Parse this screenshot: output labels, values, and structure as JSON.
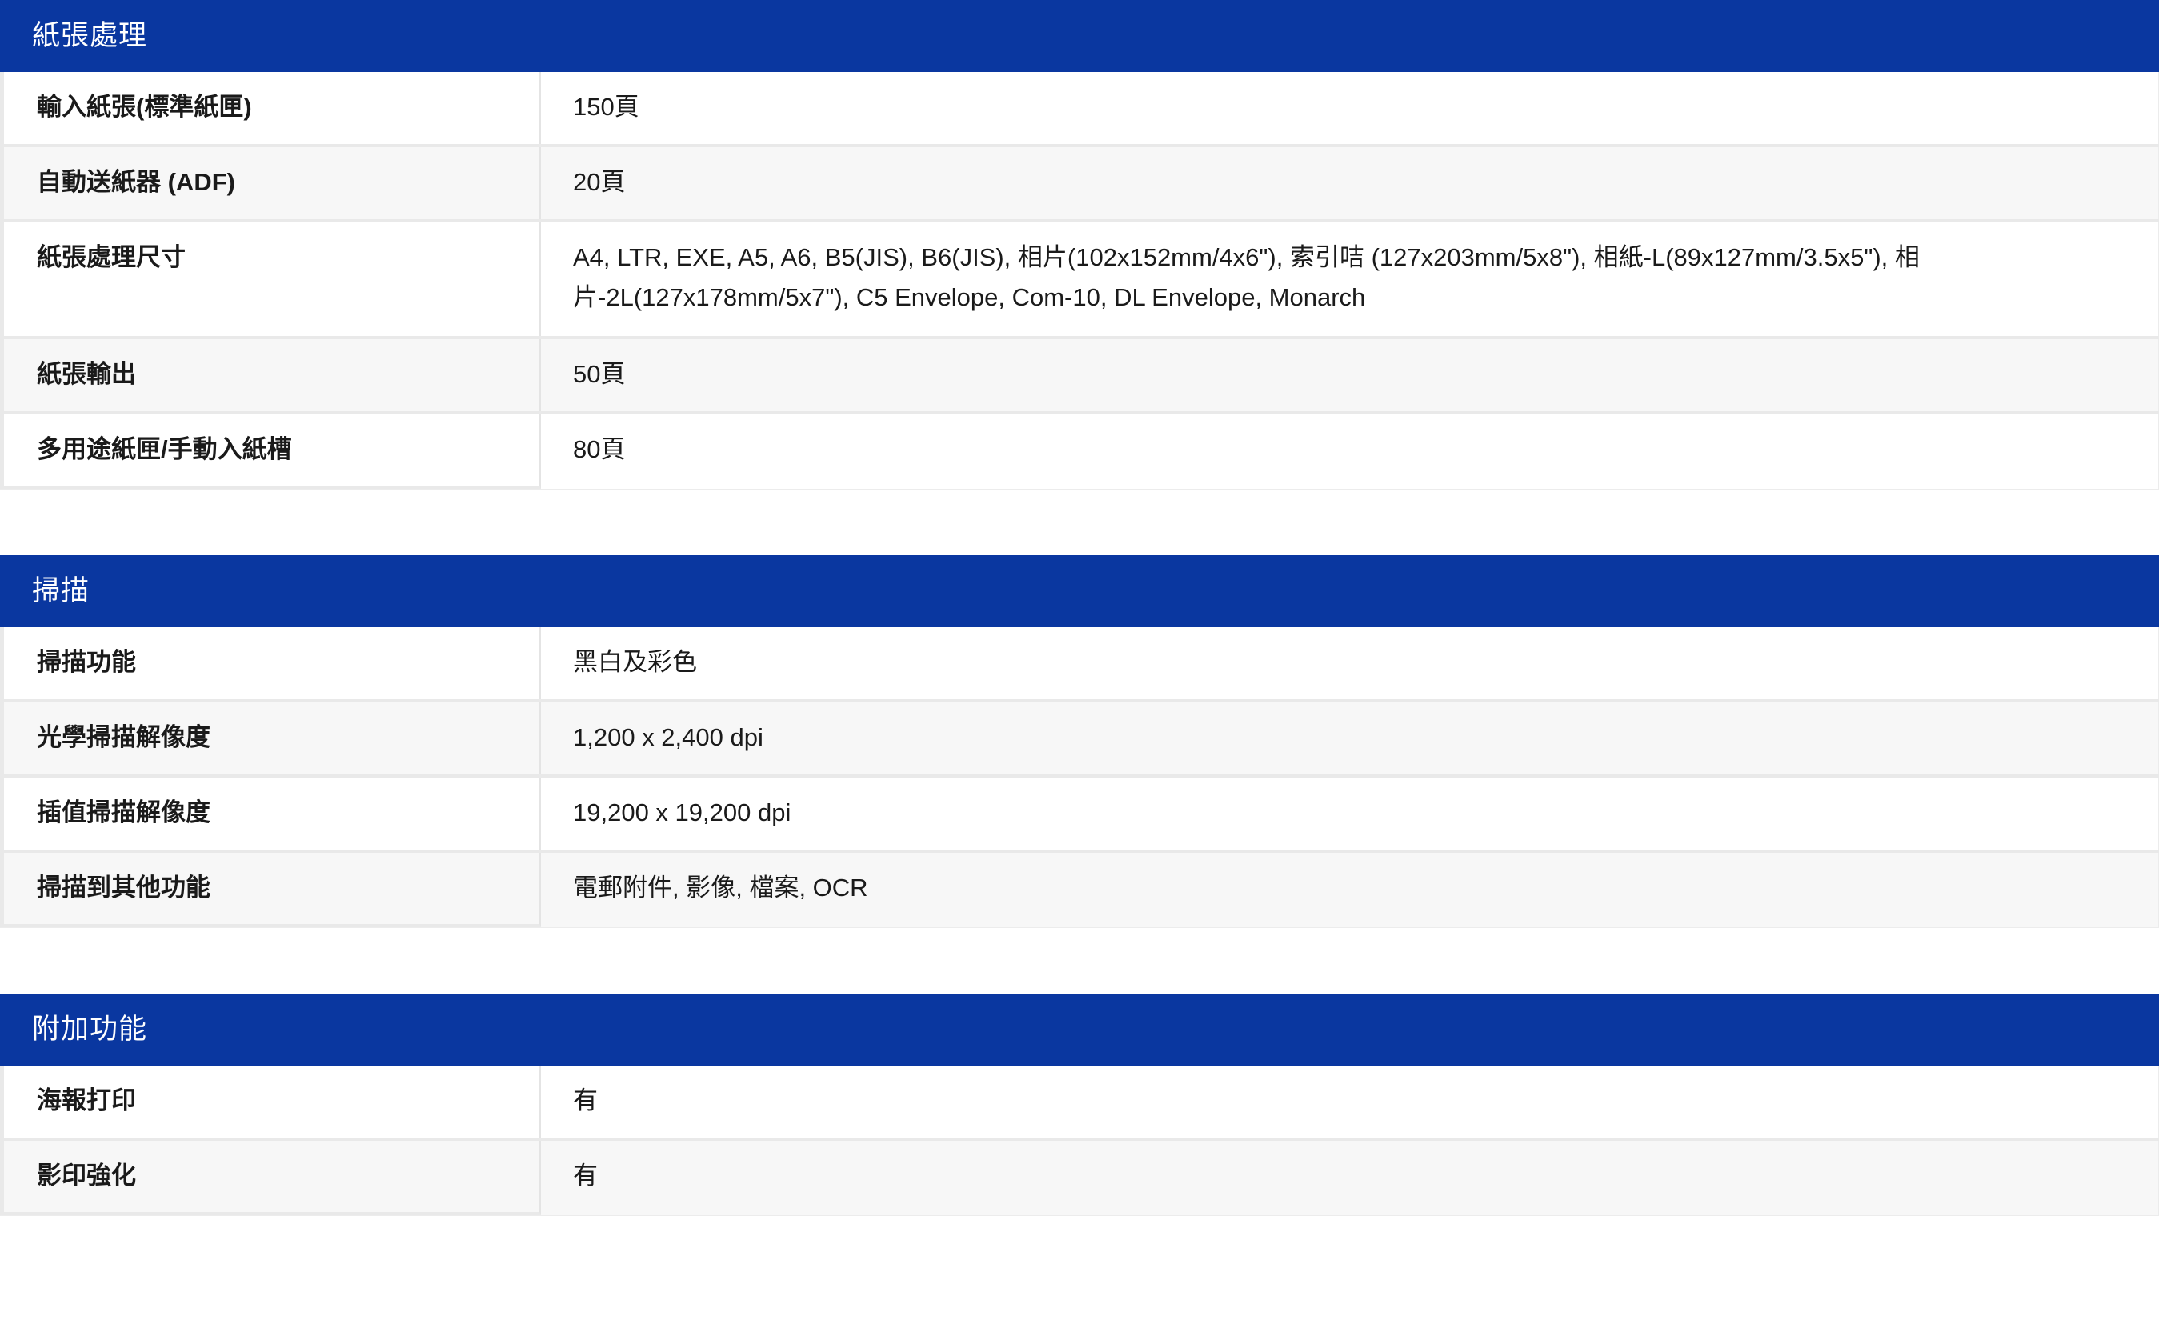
{
  "sections": [
    {
      "title": "紙張處理",
      "rows": [
        {
          "label": "輸入紙張(標準紙匣)",
          "value": "150頁"
        },
        {
          "label": "自動送紙器 (ADF)",
          "value": "20頁"
        },
        {
          "label": "紙張處理尺寸",
          "value": "A4, LTR, EXE, A5, A6, B5(JIS), B6(JIS), 相片(102x152mm/4x6\"), 索引咭 (127x203mm/5x8\"), 相紙-L(89x127mm/3.5x5\"), 相片-2L(127x178mm/5x7\"), C5 Envelope, Com-10, DL Envelope, Monarch"
        },
        {
          "label": "紙張輸出",
          "value": "50頁"
        },
        {
          "label": "多用途紙匣/手動入紙槽",
          "value": "80頁"
        }
      ]
    },
    {
      "title": "掃描",
      "rows": [
        {
          "label": "掃描功能",
          "value": "黑白及彩色"
        },
        {
          "label": "光學掃描解像度",
          "value": "1,200 x 2,400 dpi"
        },
        {
          "label": "插值掃描解像度",
          "value": "19,200 x 19,200 dpi"
        },
        {
          "label": "掃描到其他功能",
          "value": "電郵附件, 影像, 檔案, OCR"
        }
      ]
    },
    {
      "title": "附加功能",
      "rows": [
        {
          "label": "海報打印",
          "value": "有"
        },
        {
          "label": "影印強化",
          "value": "有"
        }
      ]
    }
  ],
  "colors": {
    "header_bg": "#0a37a0",
    "header_text": "#ffffff",
    "row_alt_bg": "#f7f7f7",
    "border": "#e9e9e9"
  }
}
